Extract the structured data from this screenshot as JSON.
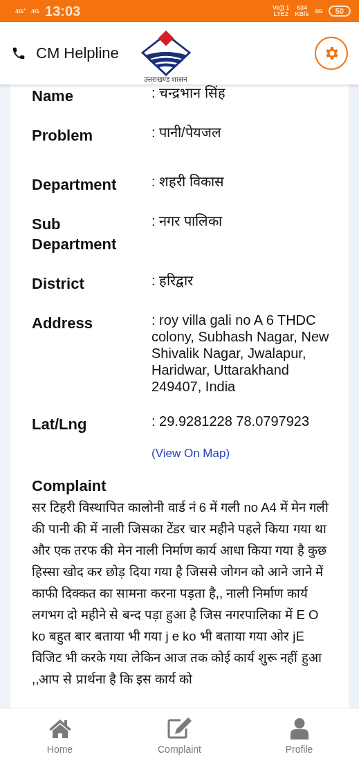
{
  "status_bar": {
    "sim_1": "4G⁺",
    "sim_2": "4G",
    "time": "13:03",
    "volte": "Vo)) 1",
    "lte": "LTE2",
    "speed": "634",
    "speed_unit": "KB/s",
    "network": "4G",
    "battery": "50"
  },
  "header": {
    "title": "CM Helpline",
    "logo_caption": "उत्तराखण्ड शासन"
  },
  "details": [
    {
      "label": "Name",
      "value": ": चन्द्रभान सिंह"
    },
    {
      "label": "Problem",
      "value": ": पानी/पेयजल"
    },
    {
      "label": "Department",
      "value": ": शहरी विकास"
    },
    {
      "label": "Sub Department",
      "value": ": नगर पालिका"
    },
    {
      "label": "District",
      "value": ": हरिद्वार"
    },
    {
      "label": "Address",
      "value": ": roy villa gali no A 6 THDC colony, Subhash Nagar, New Shivalik Nagar, Jwalapur, Haridwar, Uttarakhand 249407, India"
    },
    {
      "label": "Lat/Lng",
      "value": ": 29.9281228 78.0797923"
    }
  ],
  "map_link": "(View On Map)",
  "complaint": {
    "heading": "Complaint",
    "text": "सर टिहरी विस्थापित कालोनी वार्ड नं 6 में गली no A4 में मेन गली की पानी की में नाली जिसका टेंडर चार महीने पहले किया गया था और एक तरफ की मेन नाली निर्माण कार्य आधा किया गया है  कुछ हिस्सा खोद कर छोड़ दिया गया है जिससे जोगन को आने जाने में काफी दिक्कत का सामना करना पड़ता है,, नाली निर्माण कार्य लगभग दो महीने से बन्द पड़ा हुआ है  जिस नगरपालिका में E O ko बहुत बार बताया भी गया j e ko भी बताया गया ओर jE विजिट भी करके गया लेकिन आज तक कोई कार्य शुरू नहीं हुआ ,,आप से प्रार्थना है कि इस कार्य को"
  },
  "bottom_nav": [
    {
      "kind": "home",
      "label": "Home",
      "selected": false
    },
    {
      "kind": "complaint",
      "label": "Complaint",
      "selected": false
    },
    {
      "kind": "profile",
      "label": "Profile",
      "selected": false
    }
  ]
}
